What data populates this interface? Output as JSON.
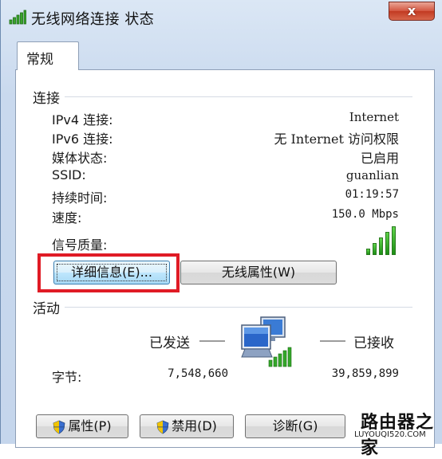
{
  "window": {
    "title": "无线网络连接 状态",
    "close_label": "x"
  },
  "tabs": [
    {
      "label": "常规"
    }
  ],
  "connection": {
    "group_label": "连接",
    "rows": [
      {
        "label": "IPv4 连接:",
        "value": "Internet"
      },
      {
        "label": "IPv6 连接:",
        "value": "无 Internet 访问权限"
      },
      {
        "label": "媒体状态:",
        "value": "已启用"
      },
      {
        "label": "SSID:",
        "value": "guanlian"
      },
      {
        "label": "持续时间:",
        "value": "01:19:57"
      },
      {
        "label": "速度:",
        "value": "150.0 Mbps"
      }
    ],
    "signal_label": "信号质量:",
    "signal_level": "5/5",
    "details_button": "详细信息(E)...",
    "wireless_props_button": "无线属性(W)"
  },
  "activity": {
    "group_label": "活动",
    "sent_label": "已发送",
    "received_label": "已接收",
    "bytes_label": "字节:",
    "bytes_sent": "7,548,660",
    "bytes_received": "39,859,899"
  },
  "buttons": {
    "properties": "属性(P)",
    "disable": "禁用(D)",
    "diagnose": "诊断(G)"
  },
  "watermark": {
    "line1": "路由器之家",
    "line2": "LUYOUQI520.COM"
  },
  "colors": {
    "highlight": "#e01b25",
    "signal": "#2fae22"
  }
}
